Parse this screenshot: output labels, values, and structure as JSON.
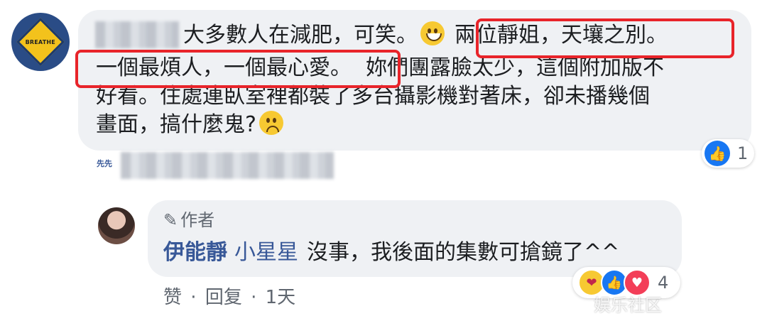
{
  "comment": {
    "avatar_text": "BREATHE",
    "line1_text": "大多數人在減肥，可笑。",
    "line1_highlight": "兩位靜姐，天壤之別。",
    "line2_highlight": "一個最煩人，一個最心愛。",
    "line2_rest": "妳們團露臉太少，這個附加版不",
    "line3": "好看。住處連臥室裡都裝了多台攝影機對著床，卻未播幾個",
    "line4": "畫面，搞什麼鬼?",
    "reaction_count": "1",
    "sub_label": "先先"
  },
  "reply": {
    "author_badge": "作者",
    "name": "伊能靜",
    "tag": "小星星",
    "text": "沒事，我後面的集數可搶鏡了^^",
    "reaction_count": "4",
    "actions": {
      "like": "赞",
      "sep1": "·",
      "reply": "回复",
      "sep2": "·",
      "time": "1天"
    }
  },
  "watermark": "娱乐社区"
}
